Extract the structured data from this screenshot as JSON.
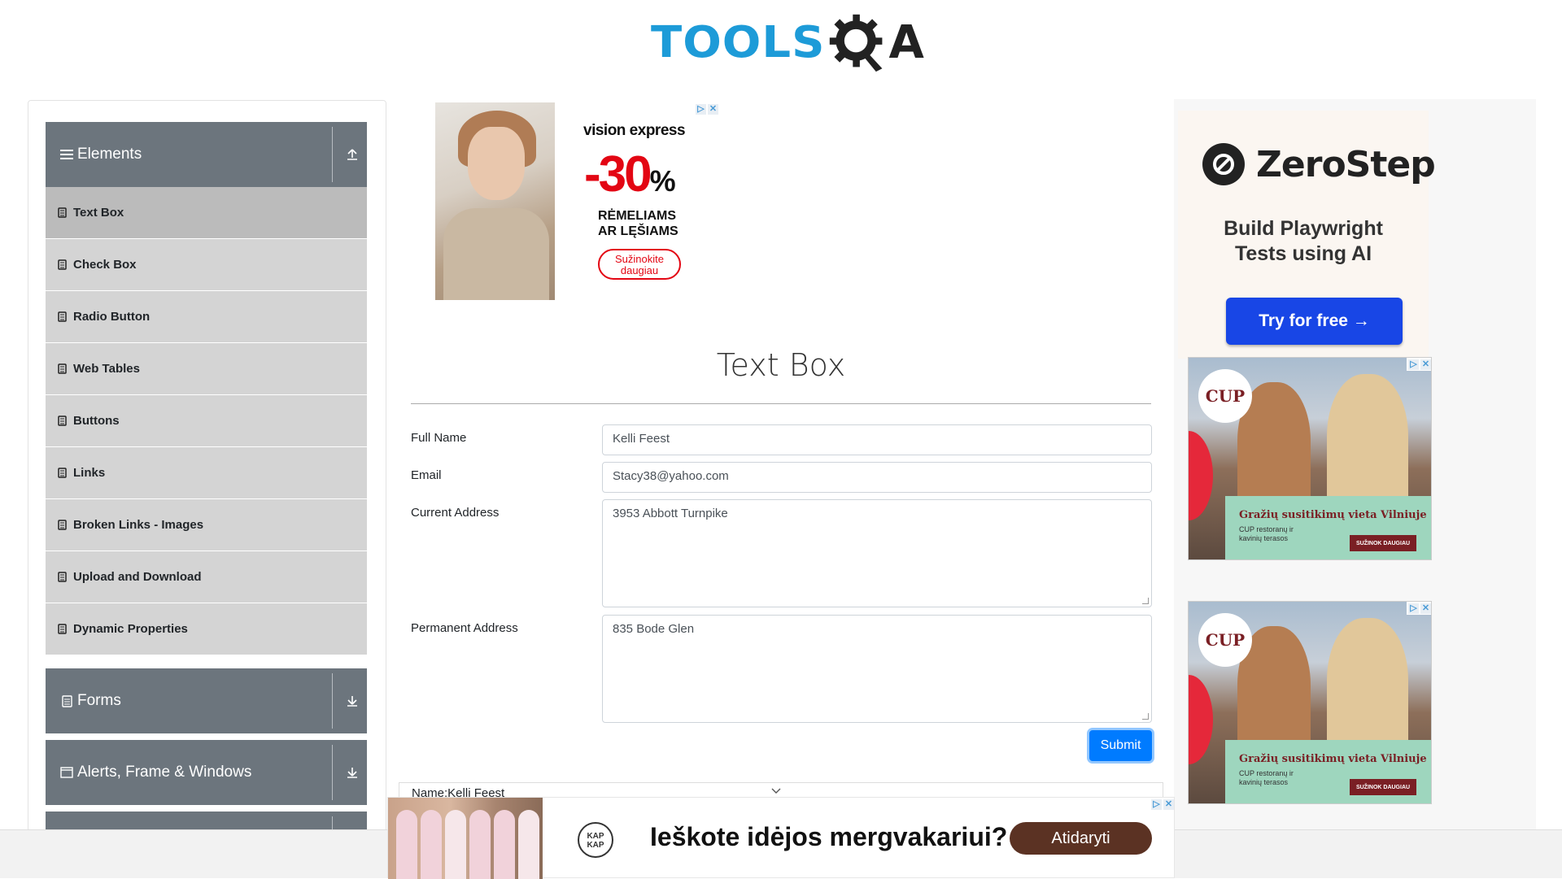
{
  "brand": {
    "logo_text_left": "TOOLS",
    "logo_text_right": "A"
  },
  "sidebar": {
    "groups": [
      {
        "label": "Elements",
        "icon": "hamburger-icon",
        "arrow": "upload-icon"
      },
      {
        "label": "Forms",
        "icon": "document-icon",
        "arrow": "download-icon"
      },
      {
        "label": "Alerts, Frame & Windows",
        "icon": "window-icon",
        "arrow": "download-icon"
      }
    ],
    "items": [
      {
        "label": "Text Box",
        "active": true
      },
      {
        "label": "Check Box"
      },
      {
        "label": "Radio Button"
      },
      {
        "label": "Web Tables"
      },
      {
        "label": "Buttons"
      },
      {
        "label": "Links"
      },
      {
        "label": "Broken Links - Images"
      },
      {
        "label": "Upload and Download"
      },
      {
        "label": "Dynamic Properties"
      }
    ]
  },
  "top_ad": {
    "brand": "vision express",
    "discount": "-30",
    "percent": "%",
    "line1": "RĖMELIAMS",
    "line2": "AR LĘŠIAMS",
    "cta_line1": "Sužinokite",
    "cta_line2": "daugiau"
  },
  "page": {
    "title": "Text Box"
  },
  "form": {
    "full_name_label": "Full Name",
    "full_name_value": "Kelli Feest",
    "email_label": "Email",
    "email_value": "Stacy38@yahoo.com",
    "current_address_label": "Current Address",
    "current_address_value": "3953 Abbott Turnpike",
    "permanent_address_label": "Permanent Address",
    "permanent_address_value": "835 Bode Glen",
    "submit_label": "Submit"
  },
  "output": {
    "name_line": "Name:Kelli Feest"
  },
  "right_ads": {
    "zerostep": {
      "name": "ZeroStep",
      "tagline_1": "Build Playwright",
      "tagline_2": "Tests using AI",
      "cta": "Try for free →"
    },
    "cup": {
      "logo": "CUP",
      "title": "Gražių susitikimų vieta Vilniuje",
      "subtitle": "CUP restoranų ir kavinių terasos",
      "cta": "SUŽINOK DAUGIAU"
    }
  },
  "bottom_ad": {
    "logo": "KAP KAP",
    "headline": "Ieškote idėjos mergvakariui?",
    "cta": "Atidaryti"
  },
  "colors": {
    "logo_blue": "#1d9bd8",
    "sidebar_header": "#6c757d",
    "sidebar_item": "#d4d4d4",
    "submit_blue": "#007bff",
    "zerostep_button": "#1846e6",
    "ad_red": "#e30613"
  }
}
